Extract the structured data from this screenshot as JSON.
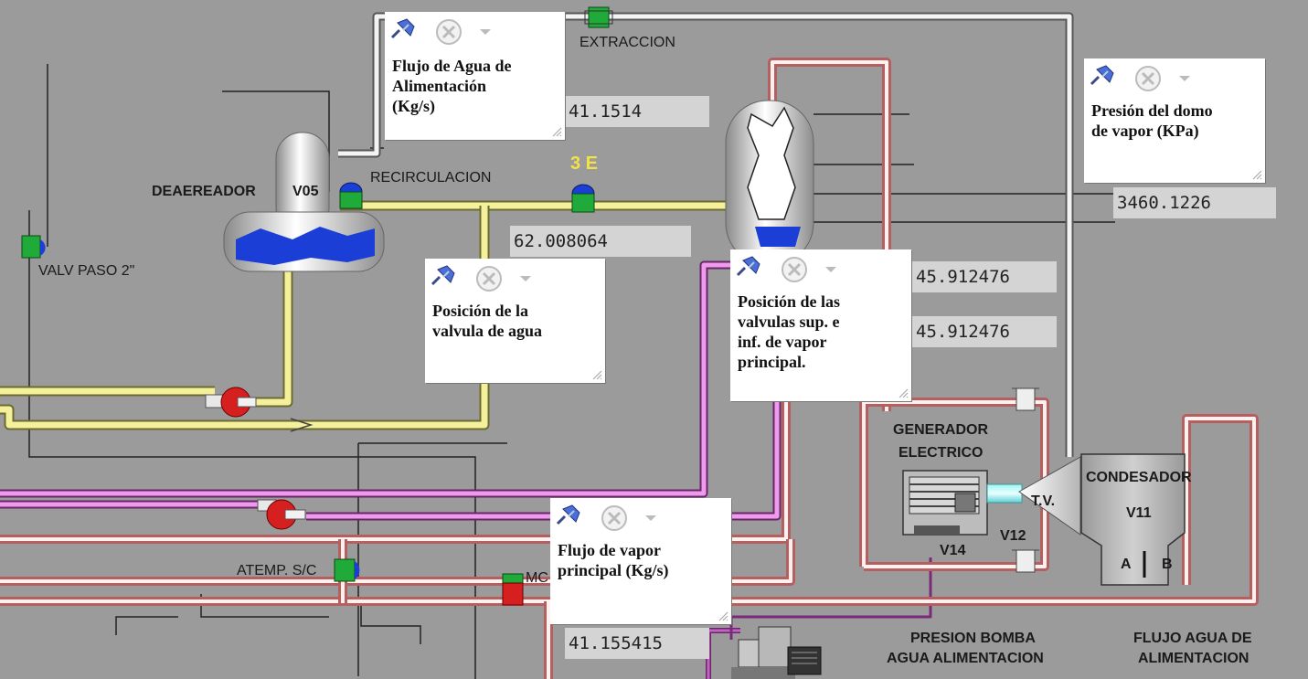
{
  "labels": {
    "extraccion": "EXTRACCION",
    "recirculacion": "RECIRCULACION",
    "deaereador": "DEAEREADOR",
    "v05": "V05",
    "valv_paso": "VALV PASO 2\"",
    "tag_3e": "3 E",
    "atemp": "ATEMP. S/C",
    "mc": "MC",
    "generador_line1": "GENERADOR",
    "generador_line2": "ELECTRICO",
    "v14": "V14",
    "v12": "V12",
    "tv": "T.V.",
    "condensador": "CONDESADOR",
    "v11": "V11",
    "a": "A",
    "b": "B",
    "presion_bomba_line1": "PRESION BOMBA",
    "presion_bomba_line2": "AGUA ALIMENTACION",
    "flujo_agua_line1": "FLUJO AGUA DE",
    "flujo_agua_line2": "ALIMENTACION"
  },
  "notes": {
    "flujo_agua": "Flujo de Agua de\nAlimentación\n(Kg/s)",
    "posicion_valvula_agua": "Posición de la\nvalvula de agua",
    "posicion_valvulas_vapor": "Posición de las\nvalvulas sup. e\ninf. de vapor\nprincipal.",
    "presion_domo": "Presión del domo\nde vapor (KPa)",
    "flujo_vapor": "Flujo de vapor\nprincipal (Kg/s)"
  },
  "values": {
    "flujo_agua": "41.1514",
    "posicion_valvula_agua": "62.008064",
    "presion_domo": "3460.1226",
    "valvula_sup": "45.912476",
    "valvula_inf": "45.912476",
    "flujo_vapor": "41.155415"
  },
  "colors": {
    "background": "#9b9b9b",
    "water_pipe": "#f2ee9a",
    "steam_pipe_outer": "#d98c8c",
    "steam_pipe_inner": "#fff4f4",
    "superheated_pipe": "#c462c4",
    "water_level": "#1b3fd6",
    "pump_red": "#d62020",
    "valve_green": "#1faa3a"
  },
  "icons": [
    "pushpin-icon",
    "close-icon",
    "dropdown-arrow-icon",
    "resize-grip-icon"
  ]
}
